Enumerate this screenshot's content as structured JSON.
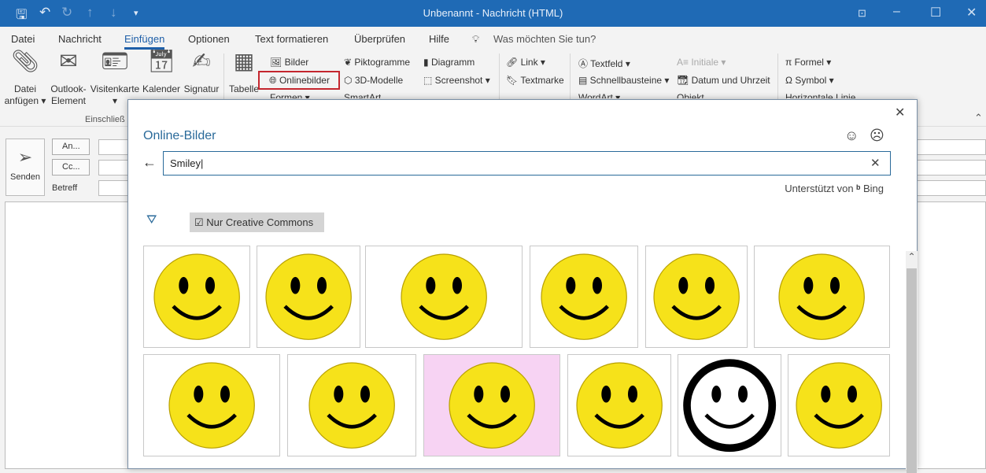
{
  "window": {
    "title": "Unbenannt  -  Nachricht (HTML)"
  },
  "tabs": [
    "Datei",
    "Nachricht",
    "Einfügen",
    "Optionen",
    "Text formatieren",
    "Überprüfen",
    "Hilfe"
  ],
  "tell_me": "Was möchten Sie tun?",
  "ribbon": {
    "big": [
      {
        "l1": "Datei",
        "l2": "anfügen ▾"
      },
      {
        "l1": "Outlook-",
        "l2": "Element"
      },
      {
        "l1": "Visitenkarte",
        "l2": "▾"
      },
      {
        "l1": "Kalender",
        "l2": ""
      },
      {
        "l1": "Signatur",
        "l2": ""
      },
      {
        "l1": "Tabelle",
        "l2": ""
      }
    ],
    "group_label": "Einschließ",
    "small": {
      "bilder": "Bilder",
      "onlinebilder": "Onlinebilder",
      "formen": "Formen ▾",
      "piktogramme": "Piktogramme",
      "modelle": "3D-Modelle",
      "smartart": "SmartArt",
      "diagramm": "Diagramm",
      "screenshot": "Screenshot ▾",
      "link": "Link  ▾",
      "textmarke": "Textmarke",
      "textfeld": "Textfeld ▾",
      "schnellbausteine": "Schnellbausteine ▾",
      "wordart": "WordArt ▾",
      "initiale": "Initiale ▾",
      "datum": "Datum und Uhrzeit",
      "objekt": "Objekt",
      "formel": "Formel  ▾",
      "symbol": "Symbol ▾",
      "linie": "Horizontale Linie"
    }
  },
  "compose": {
    "send": "Senden",
    "to": "An...",
    "cc": "Cc...",
    "subject": "Betreff"
  },
  "dialog": {
    "title": "Online-Bilder",
    "search_value": "Smiley",
    "powered_by": "Unterstützt von",
    "bing": "Bing",
    "filter_chip": "Nur Creative Commons",
    "filter_checked": true
  },
  "colors": {
    "titlebar": "#1f6ab5",
    "accent": "#1f5fa8",
    "highlight": "#c4262e",
    "smiley": "#f6e21a"
  }
}
